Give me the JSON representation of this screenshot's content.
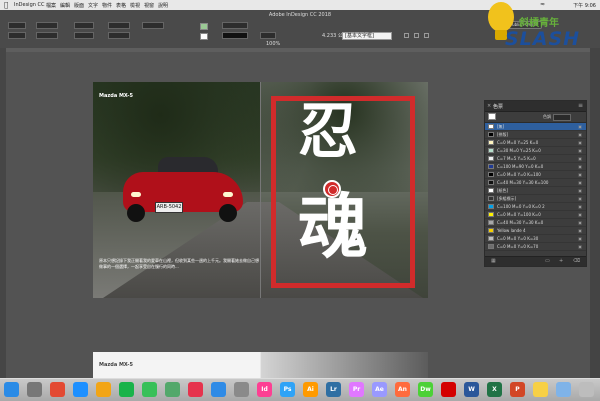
{
  "menubar": {
    "items": [
      "InDesign CC",
      "檔案",
      "編輯",
      "版面",
      "文字",
      "物件",
      "表格",
      "檢視",
      "視窗",
      "說明"
    ],
    "clock": "下午 9:06"
  },
  "control": {
    "app_title": "Adobe InDesign CC 2018",
    "coord_value": "4.233 公釐",
    "font_field": "[基本文字框]",
    "zoom": "100%",
    "publish": "Publish Online"
  },
  "logo": {
    "cn": "斜槓青年",
    "en": "SLASH"
  },
  "spread": {
    "badge": "Mazda MX-5",
    "caption": "原本只想記錄下我正開著我的愛車在山裡，但收到某些一週的上千元。我開著她去做自己想做事的一個選擇，一起享受自在慢行的同時...",
    "hanzi_top": "忍",
    "hanzi_bottom": "魂",
    "plate": "ARB-5042"
  },
  "spread2": {
    "badge": "Mazda MX-5"
  },
  "swatches": {
    "tab": "色票",
    "tint_label": "色調",
    "rows": [
      {
        "name": "[無]",
        "color": "#ffffff",
        "selected": true
      },
      {
        "name": "[拼版]",
        "color": "#000000"
      },
      {
        "name": "C=0 M=0 Y=25 K=0",
        "color": "#fff4c0"
      },
      {
        "name": "C=30 M=0 Y=25 K=0",
        "color": "#b5dfcc"
      },
      {
        "name": "C=7 M=5 Y=5 K=0",
        "color": "#ecedee"
      },
      {
        "name": "C=100 M=90 Y=0 K=0",
        "color": "#1f3a93"
      },
      {
        "name": "C=0 M=0 Y=0 K=100",
        "color": "#000000"
      },
      {
        "name": "C=40 M=30 Y=30 K=100",
        "color": "#111111"
      },
      {
        "name": "[紙色]",
        "color": "#ffffff"
      },
      {
        "name": "[多組標示]",
        "color": "#333333"
      },
      {
        "name": "C=100 M=0 Y=0 K=0 2",
        "color": "#00a0e9"
      },
      {
        "name": "C=0 M=0 Y=100 K=0",
        "color": "#fff100"
      },
      {
        "name": "C=40 M=30 Y=30 K=0",
        "color": "#a7a8aa"
      },
      {
        "name": "Yellow lande 4",
        "color": "#f5d000"
      },
      {
        "name": "C=0 M=0 Y=0 K=30",
        "color": "#bcbcbc"
      },
      {
        "name": "C=0 M=0 Y=0 K=70",
        "color": "#6e6e6e"
      }
    ]
  },
  "dock": [
    "Finder",
    "Launchpad",
    "Chrome",
    "Safari",
    "Photos",
    "LINE",
    "Messages",
    "Maps",
    "Music",
    "App Store",
    "System Preferences",
    "Id",
    "Ps",
    "Ai",
    "Lr",
    "Pr",
    "Ae",
    "An",
    "Dw",
    "Acrobat",
    "Word",
    "Excel",
    "PowerPoint",
    "Notes",
    "Folder",
    "Trash"
  ]
}
